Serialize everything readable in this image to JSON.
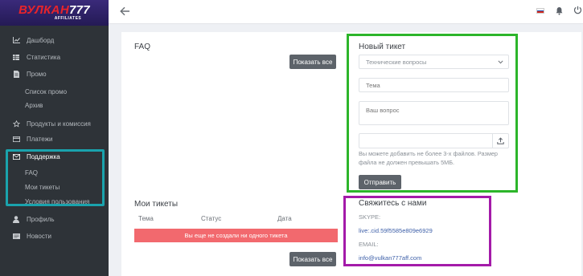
{
  "brand": {
    "logo_part1": "ВУЛКАН",
    "logo_part2": "777",
    "logo_sub": "AFFILIATES"
  },
  "sidebar": {
    "items": [
      {
        "label": "Дашборд",
        "icon": "chart-icon"
      },
      {
        "label": "Статистика",
        "icon": "table-icon"
      },
      {
        "label": "Промо",
        "icon": "file-icon"
      },
      {
        "label": "Продукты и комиссия",
        "icon": "star-icon"
      },
      {
        "label": "Платежи",
        "icon": "card-icon"
      },
      {
        "label": "Поддержка",
        "icon": "envelope-icon"
      },
      {
        "label": "Профиль",
        "icon": "user-icon"
      },
      {
        "label": "Новости",
        "icon": "news-icon"
      }
    ],
    "promo_sub": [
      "Список промо",
      "Архив"
    ],
    "support_sub": [
      "FAQ",
      "Мои тикеты",
      "Условия пользования"
    ]
  },
  "topbar": {
    "back_icon": "arrow-left-icon",
    "language_flag": "ru-flag-icon",
    "notifications_icon": "bell-icon",
    "logout_icon": "power-icon"
  },
  "faq": {
    "title": "FAQ",
    "show_all": "Показать все"
  },
  "my_tickets": {
    "title": "Мои тикеты",
    "columns": [
      "Тема",
      "Статус",
      "Дата"
    ],
    "empty_message": "Вы еще не создали ни одного тикета",
    "show_all": "Показать все"
  },
  "new_ticket": {
    "title": "Новый тикет",
    "category_selected": "Технические вопросы",
    "subject_placeholder": "Тема",
    "question_placeholder": "Ваш вопрос",
    "attach_hint": "Вы можете добавить не более 3-х файлов. Размер файла не должен превышать 5МБ.",
    "submit": "Отправить"
  },
  "contact": {
    "title": "Свяжитесь с нами",
    "skype_label": "SKYPE:",
    "skype_value": "live:.cid.59f5585e809e6929",
    "email_label": "EMAIL:",
    "email_value": "info@vulkan777aff.com"
  },
  "colors": {
    "sidebar_bg": "#2e3338",
    "highlight_cyan": "#1aa3ad",
    "highlight_green": "#2cb52a",
    "highlight_purple": "#a41aa9",
    "empty_row": "#f2696e",
    "button_dark": "#5d636a"
  }
}
